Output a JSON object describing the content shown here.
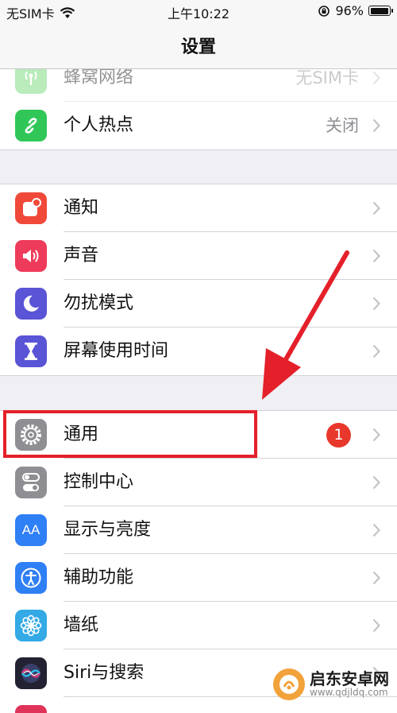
{
  "status_bar": {
    "carrier": "无SIM卡",
    "time": "上午10:22",
    "battery": "96%",
    "battery_level": 0.96
  },
  "nav": {
    "title": "设置"
  },
  "group1": [
    {
      "id": "cellular",
      "label": "蜂窝网络",
      "value": "无SIM卡",
      "icon": "antenna-icon",
      "color": "#66d36b"
    },
    {
      "id": "hotspot",
      "label": "个人热点",
      "value": "关闭",
      "icon": "link-icon",
      "color": "#31c758"
    }
  ],
  "group2": [
    {
      "id": "notifications",
      "label": "通知",
      "icon": "notification-icon",
      "color": "#f0493a"
    },
    {
      "id": "sounds",
      "label": "声音",
      "icon": "speaker-icon",
      "color": "#ef3b5b"
    },
    {
      "id": "dnd",
      "label": "勿扰模式",
      "icon": "moon-icon",
      "color": "#5a54d6"
    },
    {
      "id": "screen-time",
      "label": "屏幕使用时间",
      "icon": "hourglass-icon",
      "color": "#5a54d6"
    }
  ],
  "group3": [
    {
      "id": "general",
      "label": "通用",
      "badge": "1",
      "icon": "gear-icon",
      "color": "#8e8e93"
    },
    {
      "id": "control-center",
      "label": "控制中心",
      "icon": "toggle-icon",
      "color": "#8e8e93"
    },
    {
      "id": "display",
      "label": "显示与亮度",
      "icon": "text-size-icon",
      "color": "#2f7ff5",
      "icon_text": "AA"
    },
    {
      "id": "accessibility",
      "label": "辅助功能",
      "icon": "accessibility-icon",
      "color": "#2f7ff5"
    },
    {
      "id": "wallpaper",
      "label": "墙纸",
      "icon": "flower-icon",
      "color": "#33a9e6"
    },
    {
      "id": "siri",
      "label": "Siri与搜索",
      "icon": "siri-icon",
      "color": "#222233"
    }
  ],
  "watermark": {
    "title": "启东安卓网",
    "url": "www.qdjldq.com"
  }
}
